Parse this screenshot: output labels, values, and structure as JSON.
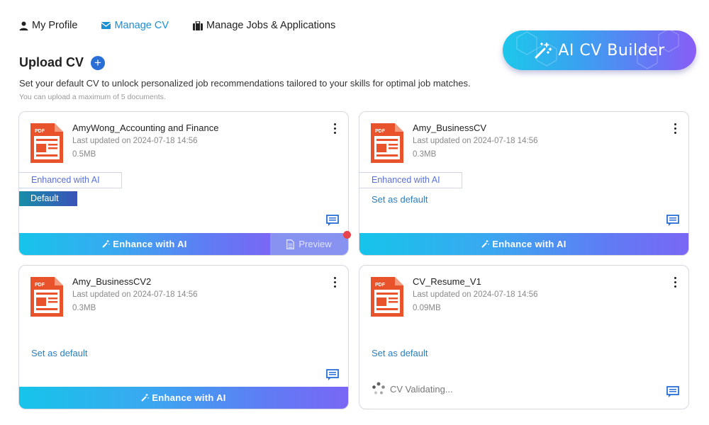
{
  "nav": {
    "items": [
      {
        "label": "My Profile"
      },
      {
        "label": "Manage CV"
      },
      {
        "label": "Manage Jobs & Applications"
      }
    ]
  },
  "ai_builder": {
    "label": "AI CV Builder"
  },
  "upload": {
    "title": "Upload CV",
    "plus": "+",
    "description": "Set your default CV to unlock personalized job recommendations tailored to your skills for optimal job matches.",
    "limit_note": "You can upload a maximum of 5 documents."
  },
  "cards": [
    {
      "name": "AmyWong_Accounting and Finance",
      "updated": "Last updated on 2024-07-18 14:56",
      "size": "0.5MB",
      "badge_ai": "Enhanced with AI",
      "badge_default": "Default",
      "enhance": "Enhance with AI",
      "preview": "Preview"
    },
    {
      "name": "Amy_BusinessCV",
      "updated": "Last updated on 2024-07-18 14:56",
      "size": "0.3MB",
      "badge_ai": "Enhanced with AI",
      "set_default": "Set as default",
      "enhance": "Enhance with AI"
    },
    {
      "name": "Amy_BusinessCV2",
      "updated": "Last updated on 2024-07-18 14:56",
      "size": "0.3MB",
      "set_default": "Set as default",
      "enhance": "Enhance with AI"
    },
    {
      "name": "CV_Resume_V1",
      "updated": "Last updated on 2024-07-18 14:56",
      "size": "0.09MB",
      "set_default": "Set as default",
      "status": "CV Validating..."
    }
  ],
  "icons": {
    "pdf_label": "PDF"
  },
  "colors": {
    "accent": "#1a8fd6",
    "pdf": "#e8532b",
    "link": "#2a7fc0",
    "notification": "#e8434a"
  }
}
